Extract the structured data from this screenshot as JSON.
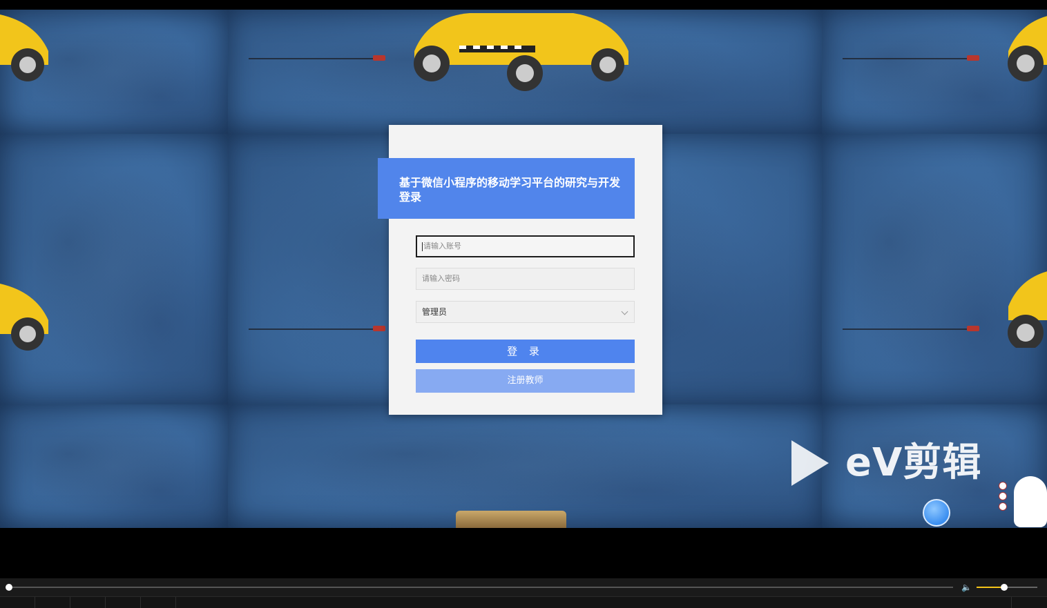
{
  "login": {
    "title": "基于微信小程序的移动学习平台的研究与开发登录",
    "account_placeholder": "请输入账号",
    "password_placeholder": "请输入密码",
    "role_selected": "管理员",
    "login_button": "登 录",
    "register_button": "注册教师"
  },
  "watermark": {
    "brand": "eV剪辑"
  },
  "player": {
    "progress": 0.0,
    "volume": 0.45
  },
  "colors": {
    "banner": "#5185eb",
    "login_button": "#4f84ee",
    "register_button": "#87aaf2",
    "background": "#3d6a9c",
    "volume_accent": "#f4c419"
  }
}
